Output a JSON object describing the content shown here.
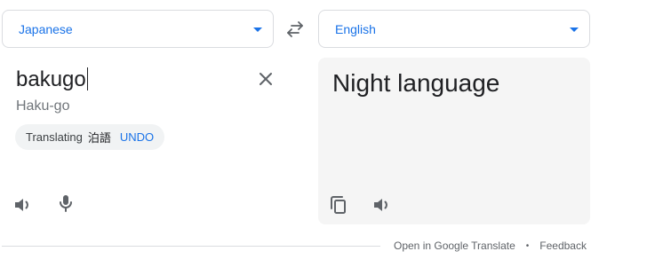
{
  "source": {
    "language": "Japanese",
    "text": "bakugo",
    "transliteration": "Haku-go",
    "translating_chip": {
      "label": "Translating",
      "term": "泊語",
      "action": "UNDO"
    },
    "icons": {
      "clear": "close-icon",
      "listen": "speaker-icon",
      "voice": "microphone-icon"
    }
  },
  "target": {
    "language": "English",
    "text": "Night language",
    "icons": {
      "copy": "copy-icon",
      "listen": "speaker-icon"
    }
  },
  "swap_icon": "swap-arrows-icon",
  "footer": {
    "open_link": "Open in Google Translate",
    "separator": "•",
    "feedback_link": "Feedback"
  },
  "colors": {
    "accent": "#1a73e8",
    "target_pane_bg": "#f5f5f5",
    "chip_bg": "#f1f3f4",
    "icon": "#5f6368"
  }
}
